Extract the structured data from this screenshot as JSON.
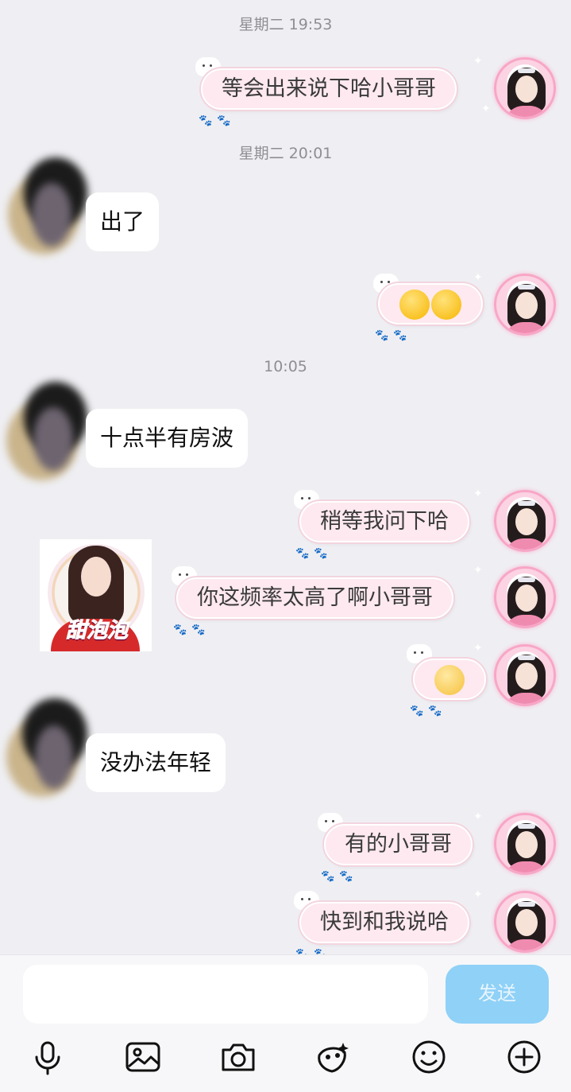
{
  "messages": {
    "ts1": "星期二 19:53",
    "m1": "等会出来说下哈小哥哥",
    "ts2": "星期二 20:01",
    "m2": "出了",
    "ts3": "10:05",
    "m4": "十点半有房波",
    "m5": "稍等我问下哈",
    "sticker_text": "甜泡泡",
    "m6": "你这频率太高了啊小哥哥",
    "m8": "没办法年轻",
    "m9": "有的小哥哥",
    "m10": "快到和我说哈"
  },
  "emojis": {
    "m3": [
      "salute-face-icon",
      "salute-face-icon"
    ],
    "m7": [
      "pleading-sweat-face-icon"
    ]
  },
  "input_bar": {
    "placeholder": "",
    "send_label": "发送"
  },
  "toolbar": [
    "microphone-icon",
    "image-icon",
    "camera-icon",
    "face-edit-icon",
    "smiley-icon",
    "plus-icon"
  ],
  "colors": {
    "my_bubble": "#fde9ef",
    "their_bubble": "#ffffff",
    "send_button": "#8fd1f7",
    "background": "#efeff3"
  }
}
